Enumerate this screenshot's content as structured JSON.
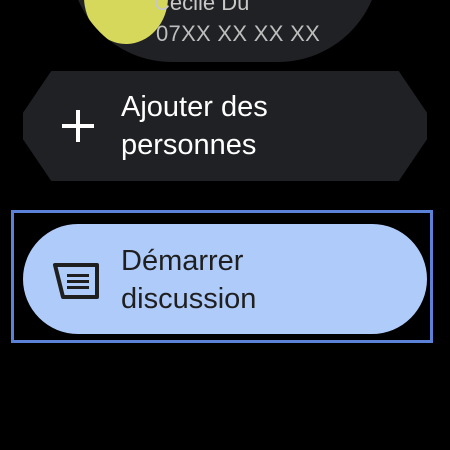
{
  "contact": {
    "name": "Cécile Du",
    "phone": "07XX XX XX XX"
  },
  "actions": {
    "add_people": {
      "label": "Ajouter des\npersonnes",
      "icon": "plus-icon"
    },
    "start_discussion": {
      "label": "Démarrer\ndiscussion",
      "icon": "chat-message-icon"
    }
  },
  "colors": {
    "chip_dark": "#202124",
    "chip_selected": "#aecbfa",
    "focus_border": "#5b82d6",
    "avatar": "#d6d85c"
  }
}
